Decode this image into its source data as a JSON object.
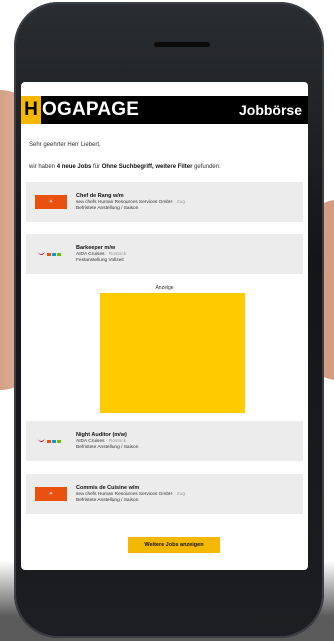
{
  "header": {
    "logo_h": "H",
    "logo_rest": "OGAPAGE",
    "section": "Jobbörse"
  },
  "email": {
    "greeting": "Sehr geehrter Herr Liebert,",
    "intro_prefix": "wir haben ",
    "intro_count": "4 neue Jobs",
    "intro_mid": " für ",
    "intro_filter": "Ohne Suchbegriff, weitere Filter",
    "intro_suffix": " gefunden:"
  },
  "jobs": [
    {
      "title": "Chef de Rang w/m",
      "company": "sea chefs Human Resources Services GmbH",
      "location": " · Zug",
      "type": "Befristete Anstellung / Saison",
      "logo": "orange"
    },
    {
      "title": "Barkeeper m/w",
      "company": "AIDA Cruises",
      "location": " · Rostock",
      "type": "Festanstellung Vollzeit",
      "logo": "aida"
    },
    {
      "title": "Night Auditor (m/w)",
      "company": "AIDA Cruises",
      "location": " · Rostock",
      "type": "Befristete Anstellung / Saison",
      "logo": "aida"
    },
    {
      "title": "Commis de Cuisine w/m",
      "company": "sea chefs Human Resources Services GmbH",
      "location": " · Zug",
      "type": "Befristete Anstellung / Saison",
      "logo": "orange"
    }
  ],
  "ad": {
    "label": "Anzeige"
  },
  "more_button": "Weitere Jobs anzeigen",
  "colors": {
    "brand_yellow": "#f5b800",
    "ad_yellow": "#ffcc00",
    "header_bg": "#000000",
    "job_bg": "#ececec"
  }
}
